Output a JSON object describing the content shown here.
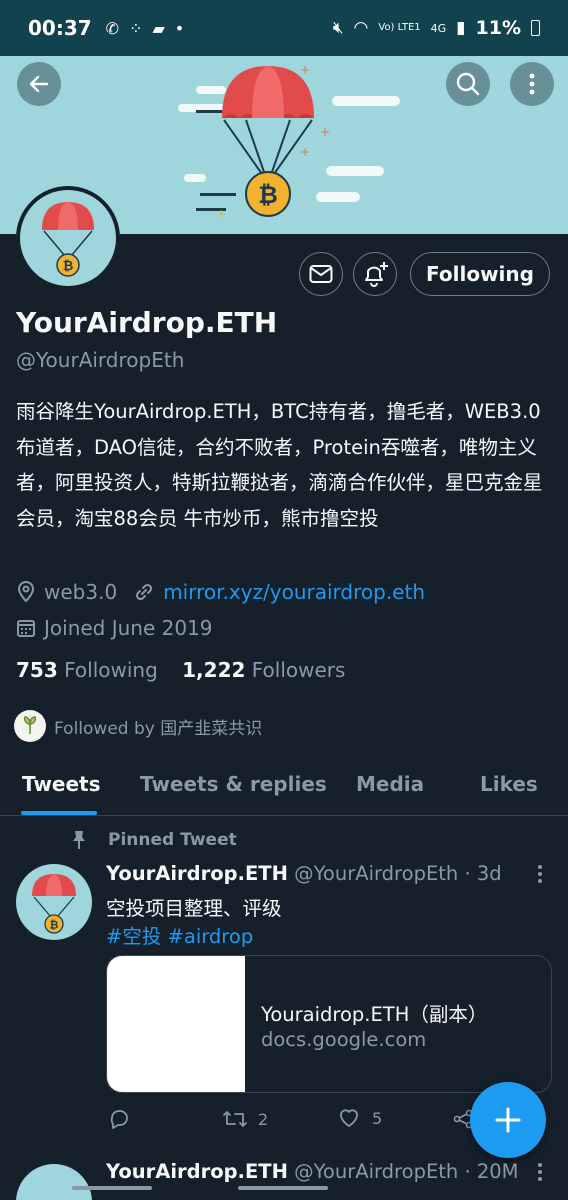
{
  "status_bar": {
    "time": "00:37",
    "battery": "11%",
    "network": "4G",
    "carrier": "Vo) LTE1"
  },
  "profile": {
    "display_name": "YourAirdrop.ETH",
    "handle": "@YourAirdropEth",
    "bio": "雨谷降生YourAirdrop.ETH，BTC持有者，撸毛者，WEB3.0布道者，DAO信徒，合约不败者，Protein吞噬者，唯物主义者，阿里投资人，特斯拉鞭挞者，滴滴合作伙伴，星巴克金星会员，淘宝88会员 牛市炒币，熊市撸空投",
    "location": "web3.0",
    "website": "mirror.xyz/yourairdrop.eth",
    "joined": "Joined June 2019",
    "following_count": "753",
    "following_label": "Following",
    "followers_count": "1,222",
    "followers_label": "Followers",
    "followed_by": "Followed by 国产韭菜共识",
    "follow_button": "Following"
  },
  "tabs": [
    {
      "label": "Tweets",
      "active": true
    },
    {
      "label": "Tweets & replies",
      "active": false
    },
    {
      "label": "Media",
      "active": false
    },
    {
      "label": "Likes",
      "active": false
    }
  ],
  "pinned_tweet": {
    "pinned_label": "Pinned Tweet",
    "name": "YourAirdrop.ETH",
    "handle_time": "@YourAirdropEth · 3d",
    "text": "空投项目整理、评级",
    "tags": "#空投 #airdrop",
    "card_title": "Youraidrop.ETH（副本）",
    "card_domain": "docs.google.com",
    "retweets": "2",
    "likes": "5"
  },
  "second_tweet": {
    "name": "YourAirdrop.ETH",
    "handle_time": "@YourAirdropEth · 20M"
  },
  "colors": {
    "background": "#15202b",
    "accent": "#1d9bf0",
    "banner": "#9ed6dc",
    "muted": "#8b98a5"
  }
}
